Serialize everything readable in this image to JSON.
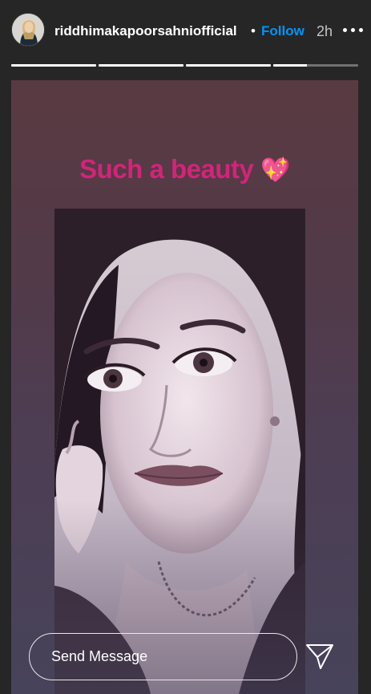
{
  "header": {
    "username": "riddhimakapoorsahniofficial",
    "separator": "•",
    "follow_label": "Follow",
    "time": "2h",
    "avatar_icon": "profile-avatar",
    "more_icon": "more-options-icon"
  },
  "progress": {
    "segments": [
      1.0,
      1.0,
      1.0,
      0.4
    ]
  },
  "story": {
    "caption": "Such a beauty",
    "caption_emoji": "💖",
    "caption_color": "#d4237a"
  },
  "reply": {
    "placeholder": "Send Message",
    "send_icon": "send-icon"
  },
  "colors": {
    "background": "#262626",
    "accent": "#0095f6"
  }
}
